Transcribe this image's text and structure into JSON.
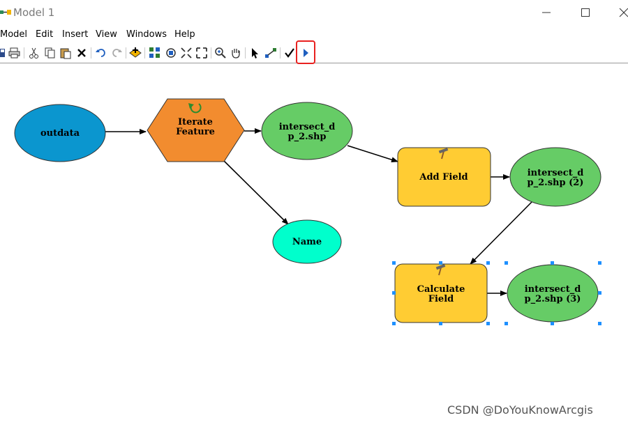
{
  "window": {
    "title": "Model 1"
  },
  "menu": [
    "Model",
    "Edit",
    "Insert",
    "View",
    "Windows",
    "Help"
  ],
  "toolbar": {
    "buttons": [
      "save-icon",
      "print-icon",
      "cut-icon",
      "copy-icon",
      "paste-icon",
      "delete-icon",
      "undo-icon",
      "redo-icon",
      "add-data-icon",
      "auto-layout-icon",
      "full-extent-icon",
      "zoom-in-fixed-icon",
      "zoom-out-fixed-icon",
      "zoom-in-icon",
      "pan-icon",
      "select-icon",
      "connect-icon",
      "validate-icon",
      "run-icon"
    ],
    "highlighted": "run-icon",
    "highlight_color": "#e8211f"
  },
  "nodes": {
    "outdata": {
      "label": [
        "outdata"
      ],
      "color": "#0b96cf"
    },
    "iterate": {
      "label": [
        "Iterate",
        "Feature"
      ],
      "color": "#f28c2f"
    },
    "intersect1": {
      "label": [
        "intersect_d",
        "p_2.shp"
      ],
      "color": "#66cc66"
    },
    "name": {
      "label": [
        "Name"
      ],
      "color": "#00ffcc"
    },
    "addfield": {
      "label": [
        "Add Field"
      ],
      "color": "#ffcc33"
    },
    "intersect2": {
      "label": [
        "intersect_d",
        "p_2.shp (2)"
      ],
      "color": "#66cc66"
    },
    "calcfield": {
      "label": [
        "Calculate",
        "Field"
      ],
      "color": "#ffcc33"
    },
    "intersect3": {
      "label": [
        "intersect_d",
        "p_2.shp (3)"
      ],
      "color": "#66cc66"
    }
  },
  "selection_color": "#1e90ff",
  "watermark": "CSDN @DoYouKnowArcgis"
}
